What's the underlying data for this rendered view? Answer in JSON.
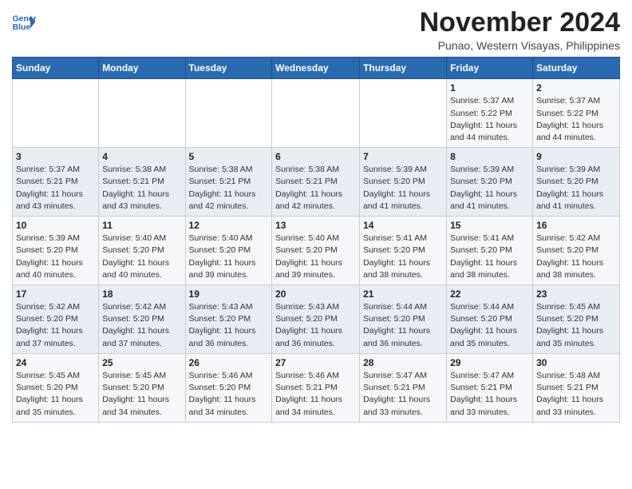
{
  "header": {
    "logo_line1": "General",
    "logo_line2": "Blue",
    "title": "November 2024",
    "subtitle": "Punao, Western Visayas, Philippines"
  },
  "columns": [
    "Sunday",
    "Monday",
    "Tuesday",
    "Wednesday",
    "Thursday",
    "Friday",
    "Saturday"
  ],
  "rows": [
    [
      {
        "date": "",
        "info": ""
      },
      {
        "date": "",
        "info": ""
      },
      {
        "date": "",
        "info": ""
      },
      {
        "date": "",
        "info": ""
      },
      {
        "date": "",
        "info": ""
      },
      {
        "date": "1",
        "info": "Sunrise: 5:37 AM\nSunset: 5:22 PM\nDaylight: 11 hours\nand 44 minutes."
      },
      {
        "date": "2",
        "info": "Sunrise: 5:37 AM\nSunset: 5:22 PM\nDaylight: 11 hours\nand 44 minutes."
      }
    ],
    [
      {
        "date": "3",
        "info": "Sunrise: 5:37 AM\nSunset: 5:21 PM\nDaylight: 11 hours\nand 43 minutes."
      },
      {
        "date": "4",
        "info": "Sunrise: 5:38 AM\nSunset: 5:21 PM\nDaylight: 11 hours\nand 43 minutes."
      },
      {
        "date": "5",
        "info": "Sunrise: 5:38 AM\nSunset: 5:21 PM\nDaylight: 11 hours\nand 42 minutes."
      },
      {
        "date": "6",
        "info": "Sunrise: 5:38 AM\nSunset: 5:21 PM\nDaylight: 11 hours\nand 42 minutes."
      },
      {
        "date": "7",
        "info": "Sunrise: 5:39 AM\nSunset: 5:20 PM\nDaylight: 11 hours\nand 41 minutes."
      },
      {
        "date": "8",
        "info": "Sunrise: 5:39 AM\nSunset: 5:20 PM\nDaylight: 11 hours\nand 41 minutes."
      },
      {
        "date": "9",
        "info": "Sunrise: 5:39 AM\nSunset: 5:20 PM\nDaylight: 11 hours\nand 41 minutes."
      }
    ],
    [
      {
        "date": "10",
        "info": "Sunrise: 5:39 AM\nSunset: 5:20 PM\nDaylight: 11 hours\nand 40 minutes."
      },
      {
        "date": "11",
        "info": "Sunrise: 5:40 AM\nSunset: 5:20 PM\nDaylight: 11 hours\nand 40 minutes."
      },
      {
        "date": "12",
        "info": "Sunrise: 5:40 AM\nSunset: 5:20 PM\nDaylight: 11 hours\nand 39 minutes."
      },
      {
        "date": "13",
        "info": "Sunrise: 5:40 AM\nSunset: 5:20 PM\nDaylight: 11 hours\nand 39 minutes."
      },
      {
        "date": "14",
        "info": "Sunrise: 5:41 AM\nSunset: 5:20 PM\nDaylight: 11 hours\nand 38 minutes."
      },
      {
        "date": "15",
        "info": "Sunrise: 5:41 AM\nSunset: 5:20 PM\nDaylight: 11 hours\nand 38 minutes."
      },
      {
        "date": "16",
        "info": "Sunrise: 5:42 AM\nSunset: 5:20 PM\nDaylight: 11 hours\nand 38 minutes."
      }
    ],
    [
      {
        "date": "17",
        "info": "Sunrise: 5:42 AM\nSunset: 5:20 PM\nDaylight: 11 hours\nand 37 minutes."
      },
      {
        "date": "18",
        "info": "Sunrise: 5:42 AM\nSunset: 5:20 PM\nDaylight: 11 hours\nand 37 minutes."
      },
      {
        "date": "19",
        "info": "Sunrise: 5:43 AM\nSunset: 5:20 PM\nDaylight: 11 hours\nand 36 minutes."
      },
      {
        "date": "20",
        "info": "Sunrise: 5:43 AM\nSunset: 5:20 PM\nDaylight: 11 hours\nand 36 minutes."
      },
      {
        "date": "21",
        "info": "Sunrise: 5:44 AM\nSunset: 5:20 PM\nDaylight: 11 hours\nand 36 minutes."
      },
      {
        "date": "22",
        "info": "Sunrise: 5:44 AM\nSunset: 5:20 PM\nDaylight: 11 hours\nand 35 minutes."
      },
      {
        "date": "23",
        "info": "Sunrise: 5:45 AM\nSunset: 5:20 PM\nDaylight: 11 hours\nand 35 minutes."
      }
    ],
    [
      {
        "date": "24",
        "info": "Sunrise: 5:45 AM\nSunset: 5:20 PM\nDaylight: 11 hours\nand 35 minutes."
      },
      {
        "date": "25",
        "info": "Sunrise: 5:45 AM\nSunset: 5:20 PM\nDaylight: 11 hours\nand 34 minutes."
      },
      {
        "date": "26",
        "info": "Sunrise: 5:46 AM\nSunset: 5:20 PM\nDaylight: 11 hours\nand 34 minutes."
      },
      {
        "date": "27",
        "info": "Sunrise: 5:46 AM\nSunset: 5:21 PM\nDaylight: 11 hours\nand 34 minutes."
      },
      {
        "date": "28",
        "info": "Sunrise: 5:47 AM\nSunset: 5:21 PM\nDaylight: 11 hours\nand 33 minutes."
      },
      {
        "date": "29",
        "info": "Sunrise: 5:47 AM\nSunset: 5:21 PM\nDaylight: 11 hours\nand 33 minutes."
      },
      {
        "date": "30",
        "info": "Sunrise: 5:48 AM\nSunset: 5:21 PM\nDaylight: 11 hours\nand 33 minutes."
      }
    ]
  ]
}
